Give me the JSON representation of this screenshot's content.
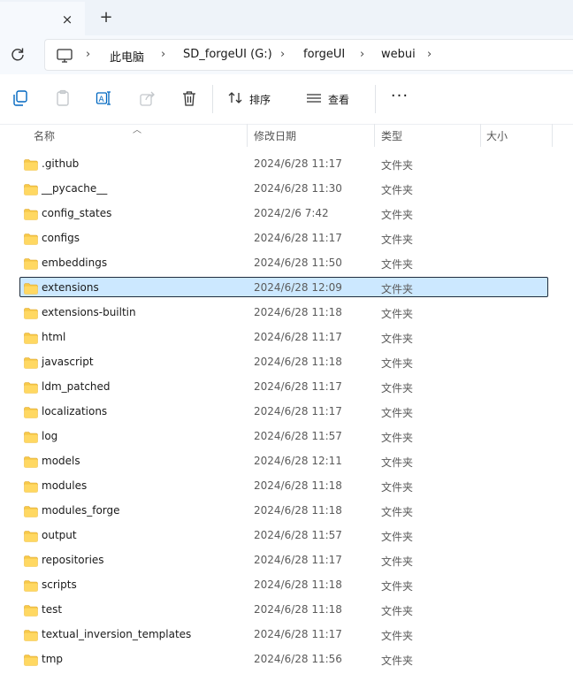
{
  "tabbar": {
    "close_icon": "×",
    "new_tab_icon": "+"
  },
  "address": {
    "crumbs": [
      "此电脑",
      "SD_forgeUI (G:)",
      "forgeUI",
      "webui"
    ],
    "separator": "›"
  },
  "toolbar": {
    "sort_label": "排序",
    "view_label": "查看",
    "more_label": "···"
  },
  "columns": {
    "name": "名称",
    "date": "修改日期",
    "type": "类型",
    "size": "大小"
  },
  "colors": {
    "selected_bg": "#cce8ff",
    "folder": "#f7c948",
    "accent": "#0067c0"
  },
  "files": [
    {
      "name": ".github",
      "date": "2024/6/28 11:17",
      "type": "文件夹"
    },
    {
      "name": "__pycache__",
      "date": "2024/6/28 11:30",
      "type": "文件夹"
    },
    {
      "name": "config_states",
      "date": "2024/2/6 7:42",
      "type": "文件夹"
    },
    {
      "name": "configs",
      "date": "2024/6/28 11:17",
      "type": "文件夹"
    },
    {
      "name": "embeddings",
      "date": "2024/6/28 11:50",
      "type": "文件夹"
    },
    {
      "name": "extensions",
      "date": "2024/6/28 12:09",
      "type": "文件夹",
      "selected": true
    },
    {
      "name": "extensions-builtin",
      "date": "2024/6/28 11:18",
      "type": "文件夹"
    },
    {
      "name": "html",
      "date": "2024/6/28 11:17",
      "type": "文件夹"
    },
    {
      "name": "javascript",
      "date": "2024/6/28 11:18",
      "type": "文件夹"
    },
    {
      "name": "ldm_patched",
      "date": "2024/6/28 11:17",
      "type": "文件夹"
    },
    {
      "name": "localizations",
      "date": "2024/6/28 11:17",
      "type": "文件夹"
    },
    {
      "name": "log",
      "date": "2024/6/28 11:57",
      "type": "文件夹"
    },
    {
      "name": "models",
      "date": "2024/6/28 12:11",
      "type": "文件夹"
    },
    {
      "name": "modules",
      "date": "2024/6/28 11:18",
      "type": "文件夹"
    },
    {
      "name": "modules_forge",
      "date": "2024/6/28 11:18",
      "type": "文件夹"
    },
    {
      "name": "output",
      "date": "2024/6/28 11:57",
      "type": "文件夹"
    },
    {
      "name": "repositories",
      "date": "2024/6/28 11:17",
      "type": "文件夹"
    },
    {
      "name": "scripts",
      "date": "2024/6/28 11:18",
      "type": "文件夹"
    },
    {
      "name": "test",
      "date": "2024/6/28 11:18",
      "type": "文件夹"
    },
    {
      "name": "textual_inversion_templates",
      "date": "2024/6/28 11:17",
      "type": "文件夹"
    },
    {
      "name": "tmp",
      "date": "2024/6/28 11:56",
      "type": "文件夹"
    }
  ]
}
